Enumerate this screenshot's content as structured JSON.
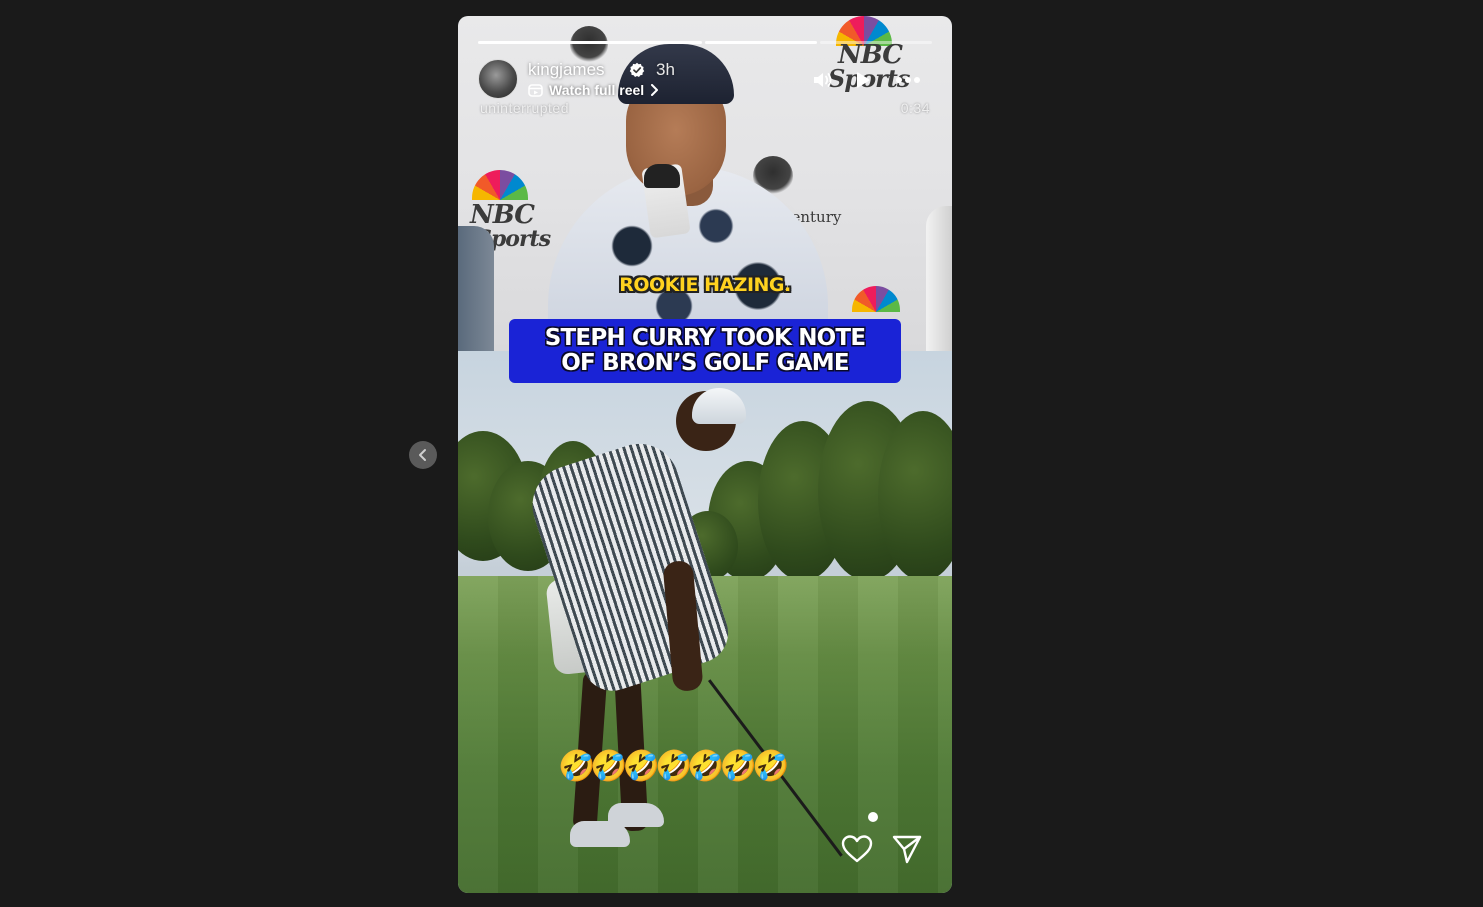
{
  "story": {
    "username": "kingjames",
    "time_ago": "3h",
    "reel_link_label": "Watch full reel",
    "source_watermark": "uninterrupted",
    "duration": "0:34",
    "progress_segments": [
      {
        "state": "viewed",
        "fraction": 1.0
      },
      {
        "state": "viewed",
        "fraction": 1.0
      },
      {
        "state": "current",
        "fraction": 0.0
      }
    ]
  },
  "video": {
    "caption_top": "ROOKIE HAZING.",
    "title_line_1": "STEPH CURRY TOOK NOTE",
    "title_line_2": "OF BRON’S GOLF GAME",
    "emoji_text": "🤣🤣🤣🤣🤣🤣🤣",
    "backdrop_logo_1": "NBC",
    "backdrop_logo_2": "Sports",
    "backdrop_text_3": "Century",
    "backdrop_text_4": "ts"
  },
  "icons": {
    "prev": "chevron-left-icon",
    "volume": "volume-icon",
    "play": "play-icon",
    "more": "more-dots-icon",
    "like": "heart-icon",
    "share": "send-icon",
    "verified": "verified-badge-icon",
    "reel": "reel-icon"
  },
  "colors": {
    "page_background": "#1a1a1a",
    "title_box": "#1a23d6",
    "caption_yellow": "#ffd21f",
    "verified_blue": "#ffffff"
  }
}
